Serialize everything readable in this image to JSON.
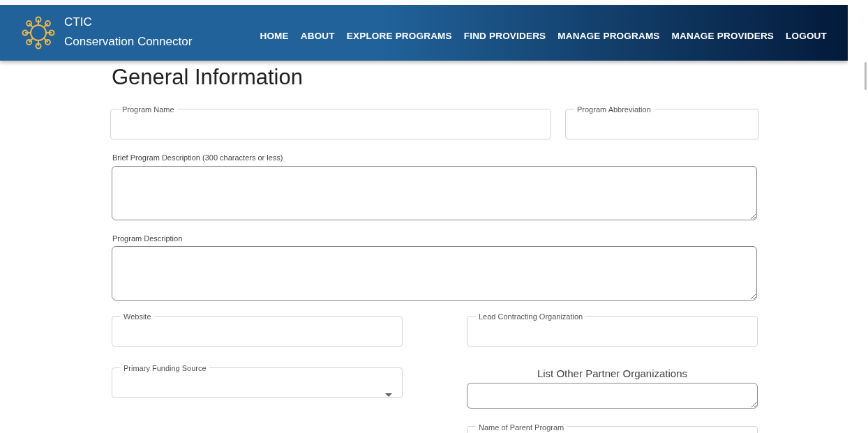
{
  "header": {
    "brand_short": "CTIC",
    "brand_name": "Conservation Connector",
    "nav": [
      {
        "label": "HOME"
      },
      {
        "label": "ABOUT"
      },
      {
        "label": "EXPLORE PROGRAMS"
      },
      {
        "label": "FIND PROVIDERS"
      },
      {
        "label": "MANAGE PROGRAMS"
      },
      {
        "label": "MANAGE PROVIDERS"
      },
      {
        "label": "LOGOUT"
      }
    ]
  },
  "form": {
    "title": "General Information",
    "sections": [
      {
        "kind": "pair",
        "fields": [
          {
            "kind": "outlined",
            "label": "Program Name"
          },
          {
            "kind": "outlined",
            "label": "Program Abbreviation"
          }
        ]
      },
      {
        "kind": "full",
        "fields": [
          {
            "kind": "textarea",
            "label": "Brief Program Description (300 characters or less)"
          }
        ]
      },
      {
        "kind": "full",
        "fields": [
          {
            "kind": "textarea",
            "label": "Program Description"
          }
        ]
      },
      {
        "kind": "columns",
        "columns": [
          [
            {
              "kind": "outlined",
              "label": "Website"
            },
            {
              "kind": "select",
              "label": "Primary Funding Source"
            }
          ],
          [
            {
              "kind": "outlined",
              "label": "Lead Contracting Organization"
            },
            {
              "kind": "heading-textarea",
              "label": "List Other Partner Organizations"
            },
            {
              "kind": "outlined",
              "label": "Name of Parent Program"
            }
          ]
        ]
      }
    ]
  }
}
